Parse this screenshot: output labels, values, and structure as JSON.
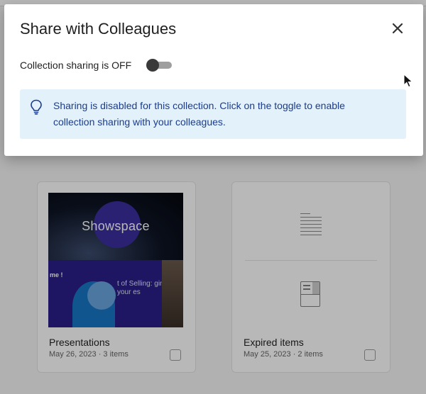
{
  "modal": {
    "title": "Share with Colleagues",
    "toggle_label": "Collection sharing is OFF",
    "toggle_on": false,
    "info_text": "Sharing is disabled for this collection. Click on the toggle to enable collection sharing with your colleagues."
  },
  "cards": [
    {
      "title": "Presentations",
      "meta": "May 26, 2023 · 3 items",
      "thumb_brand": "Showspace",
      "thumb_snippet_left": "me !",
      "thumb_snippet_right": "t of Selling: ging your es"
    },
    {
      "title": "Expired items",
      "meta": "May 25, 2023 · 2 items"
    }
  ],
  "colors": {
    "accent": "#1b3c8c",
    "info_bg": "#e3f1fb",
    "toggle_off": "#9e9e9e"
  },
  "icons": {
    "close": "close-icon",
    "info": "lightbulb-icon",
    "doc": "document-icon",
    "layout": "layout-icon"
  }
}
